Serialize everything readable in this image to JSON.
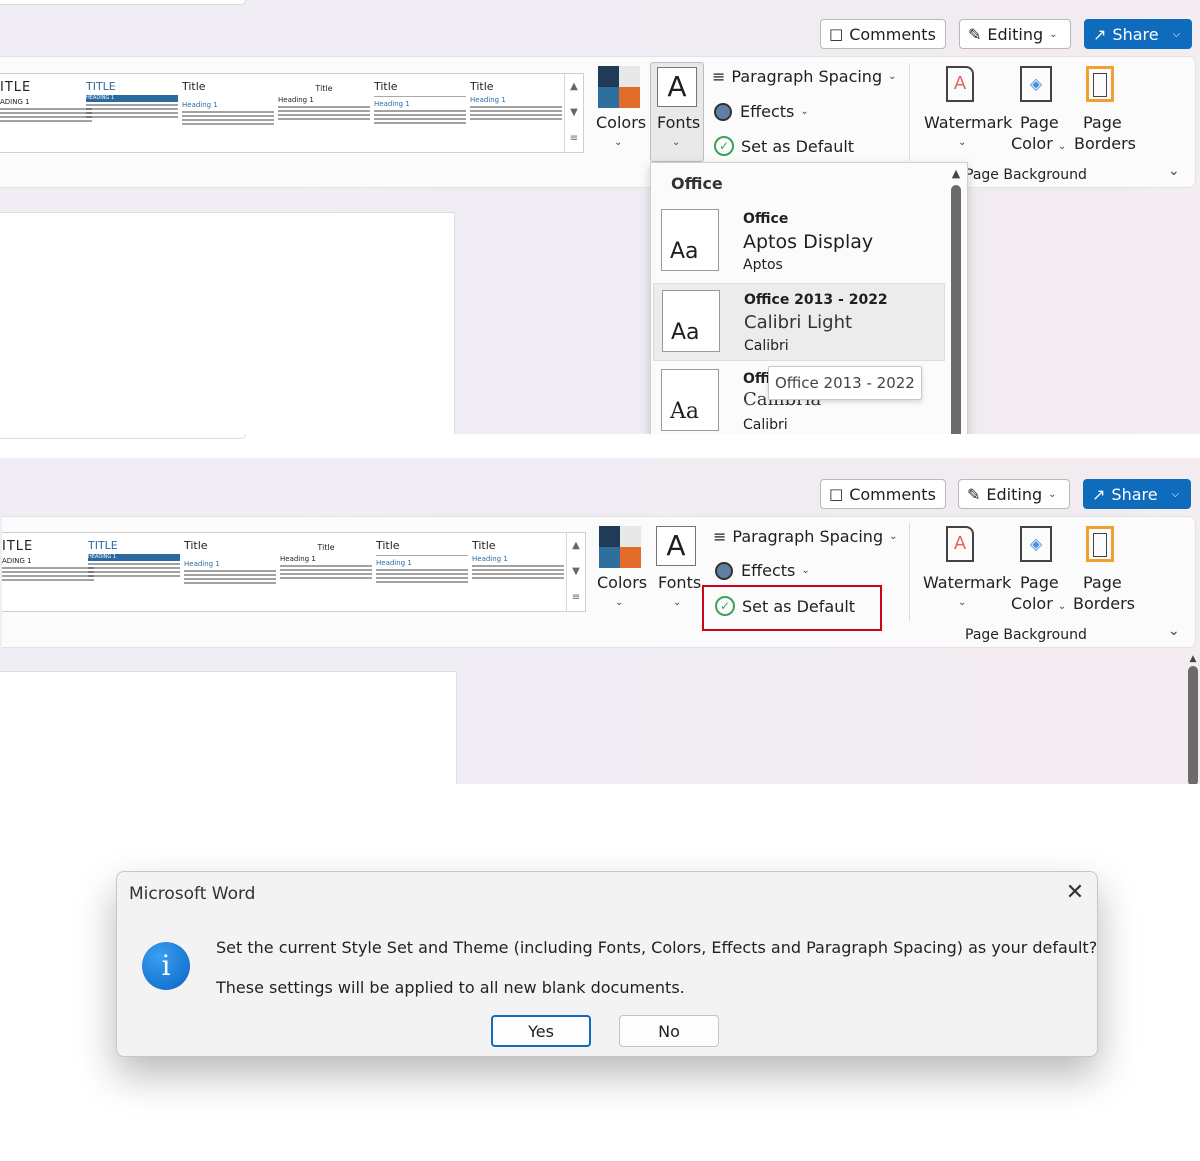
{
  "top_buttons": {
    "comments": "Comments",
    "editing": "Editing",
    "share": "Share"
  },
  "gallery": {
    "thumbs": [
      {
        "title": "ITLE",
        "heading": "ADING 1"
      },
      {
        "title": "TITLE",
        "heading": "HEADING 1"
      },
      {
        "title": "Title",
        "heading": "Heading 1"
      },
      {
        "title": "Title",
        "heading": "Heading 1"
      },
      {
        "title": "Title",
        "heading": "Heading 1"
      },
      {
        "title": "Title",
        "heading": "Heading 1"
      }
    ]
  },
  "ribbon": {
    "colors_label": "Colors",
    "fonts_label": "Fonts",
    "fonts_glyph": "A",
    "paragraph_spacing": "Paragraph Spacing",
    "effects": "Effects",
    "set_as_default": "Set as Default",
    "watermark": "Watermark",
    "page_color_line1": "Page",
    "page_color_line2": "Color",
    "page_borders_line1": "Page",
    "page_borders_line2": "Borders",
    "page_background": "Page Background",
    "colors_swatch": [
      "#1f3b57",
      "#e8e8e8",
      "#2f6f9e",
      "#e46c2a"
    ],
    "highlight_color": "#d0021b"
  },
  "fonts_dropdown": {
    "header": "Office",
    "items": [
      {
        "name": "Office",
        "heading_font": "Aptos Display",
        "body_font": "Aptos"
      },
      {
        "name": "Office 2013 - 2022",
        "heading_font": "Calibri Light",
        "body_font": "Calibri"
      },
      {
        "name": "Offi",
        "heading_font": "Cambria",
        "body_font": "Calibri"
      }
    ],
    "aa": "Aa",
    "tooltip": "Office 2013 - 2022"
  },
  "dialog": {
    "title": "Microsoft Word",
    "message": "Set the current Style Set and Theme (including Fonts, Colors, Effects and Paragraph Spacing) as your default?",
    "submessage": "These settings will be applied to all new blank documents.",
    "yes": "Yes",
    "no": "No",
    "info_glyph": "i"
  }
}
